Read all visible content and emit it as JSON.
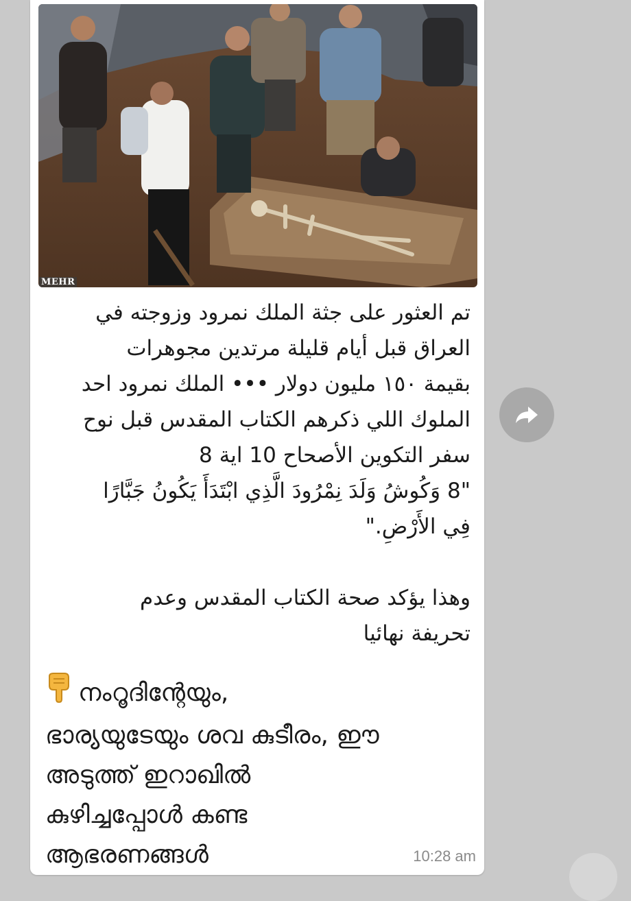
{
  "message": {
    "image": {
      "watermark": "MEHR"
    },
    "arabic_lines": [
      "تم العثور على جثة الملك نمرود وزوجته في",
      "العراق قبل أيام قليلة مرتدين مجوهرات",
      "بقيمة ١٥٠ مليون دولار ••• الملك نمرود احد",
      "الملوك اللي ذكرهم الكتاب المقدس قبل نوح",
      "سفر التكوين الأصحاح 10 اية 8",
      "\"8 وَكُوشُ وَلَدَ نِمْرُودَ الَّذِي ابْتَدَأَ يَكُونُ جَبَّارًا",
      "فِي الأَرْضِ.\"",
      "",
      "وهذا يؤكد صحة الكتاب المقدس وعدم",
      "تحريفة نهائيا"
    ],
    "malayalam_lines": [
      "നംറൂദിന്റേയും,",
      "ഭാര്യയുടേയും ശവ കുടീരം, ഈ",
      "അടുത്ത് ഇറാഖിൽ",
      "കുഴിച്ചപ്പോൾ കണ്ട",
      "ആഭരണങ്ങൾ"
    ],
    "leading_emoji": "pointing-down-hand-icon",
    "time": "10:28 am"
  },
  "actions": {
    "forward_icon": "forward-share-icon"
  },
  "colors": {
    "bubble": "#ffffff",
    "background": "#c9c9c9",
    "share_button": "#a9a9a9",
    "timestamp": "#8a8a8a"
  }
}
